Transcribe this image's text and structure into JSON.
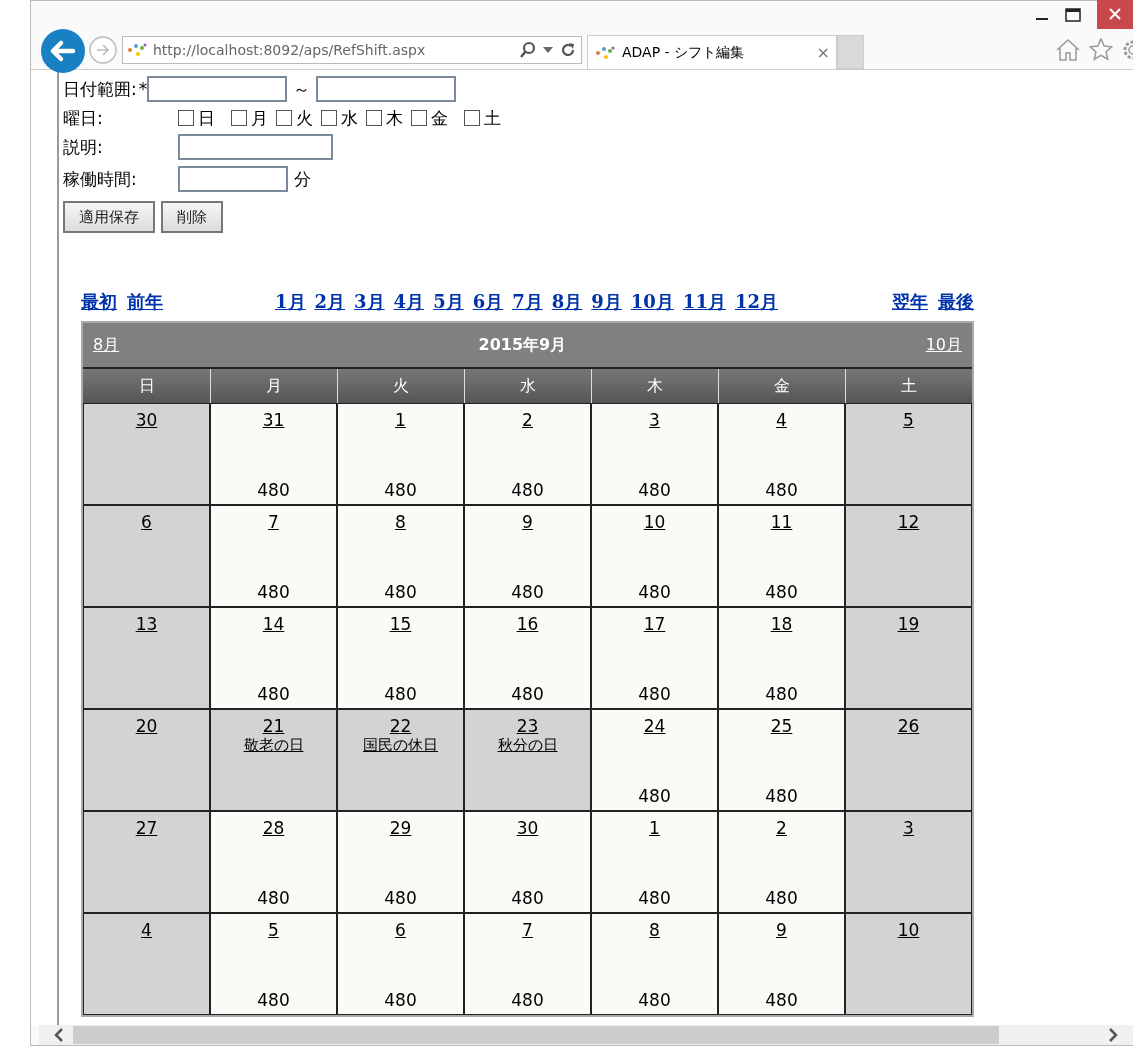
{
  "browser": {
    "url": "http://localhost:8092/aps/RefShift.aspx",
    "tab_title": "ADAP - シフト編集",
    "tab_close": "×"
  },
  "form": {
    "date_range_label": "日付範囲:",
    "required_mark": "*",
    "range_separator": "～",
    "weekday_label": "曜日:",
    "weekdays": [
      {
        "label": "日",
        "checked": false
      },
      {
        "label": "月",
        "checked": false
      },
      {
        "label": "火",
        "checked": false
      },
      {
        "label": "水",
        "checked": false
      },
      {
        "label": "木",
        "checked": false
      },
      {
        "label": "金",
        "checked": false
      },
      {
        "label": "土",
        "checked": false
      }
    ],
    "description_label": "説明:",
    "hours_label": "稼働時間:",
    "hours_unit": "分",
    "buttons": [
      "適用保存",
      "削除"
    ]
  },
  "nav": {
    "left": [
      "最初",
      "前年"
    ],
    "months": [
      "1月",
      "2月",
      "3月",
      "4月",
      "5月",
      "6月",
      "7月",
      "8月",
      "9月",
      "10月",
      "11月",
      "12月"
    ],
    "right": [
      "翌年",
      "最後"
    ]
  },
  "calendar": {
    "prev": "8月",
    "title": "2015年9月",
    "next": "10月",
    "day_headers": [
      "日",
      "月",
      "火",
      "水",
      "木",
      "金",
      "土"
    ],
    "weeks": [
      [
        {
          "day": "30",
          "off": true
        },
        {
          "day": "31",
          "off": false,
          "minutes": "480"
        },
        {
          "day": "1",
          "off": false,
          "minutes": "480"
        },
        {
          "day": "2",
          "off": false,
          "minutes": "480"
        },
        {
          "day": "3",
          "off": false,
          "minutes": "480"
        },
        {
          "day": "4",
          "off": false,
          "minutes": "480"
        },
        {
          "day": "5",
          "off": true
        }
      ],
      [
        {
          "day": "6",
          "off": true
        },
        {
          "day": "7",
          "off": false,
          "minutes": "480"
        },
        {
          "day": "8",
          "off": false,
          "minutes": "480"
        },
        {
          "day": "9",
          "off": false,
          "minutes": "480"
        },
        {
          "day": "10",
          "off": false,
          "minutes": "480"
        },
        {
          "day": "11",
          "off": false,
          "minutes": "480"
        },
        {
          "day": "12",
          "off": true
        }
      ],
      [
        {
          "day": "13",
          "off": true
        },
        {
          "day": "14",
          "off": false,
          "minutes": "480"
        },
        {
          "day": "15",
          "off": false,
          "minutes": "480"
        },
        {
          "day": "16",
          "off": false,
          "minutes": "480"
        },
        {
          "day": "17",
          "off": false,
          "minutes": "480"
        },
        {
          "day": "18",
          "off": false,
          "minutes": "480"
        },
        {
          "day": "19",
          "off": true
        }
      ],
      [
        {
          "day": "20",
          "off": true
        },
        {
          "day": "21",
          "off": true,
          "holiday": "敬老の日"
        },
        {
          "day": "22",
          "off": true,
          "holiday": "国民の休日"
        },
        {
          "day": "23",
          "off": true,
          "holiday": "秋分の日"
        },
        {
          "day": "24",
          "off": false,
          "minutes": "480"
        },
        {
          "day": "25",
          "off": false,
          "minutes": "480"
        },
        {
          "day": "26",
          "off": true
        }
      ],
      [
        {
          "day": "27",
          "off": true
        },
        {
          "day": "28",
          "off": false,
          "minutes": "480"
        },
        {
          "day": "29",
          "off": false,
          "minutes": "480"
        },
        {
          "day": "30",
          "off": false,
          "minutes": "480"
        },
        {
          "day": "1",
          "off": false,
          "minutes": "480"
        },
        {
          "day": "2",
          "off": false,
          "minutes": "480"
        },
        {
          "day": "3",
          "off": true
        }
      ],
      [
        {
          "day": "4",
          "off": true
        },
        {
          "day": "5",
          "off": false,
          "minutes": "480"
        },
        {
          "day": "6",
          "off": false,
          "minutes": "480"
        },
        {
          "day": "7",
          "off": false,
          "minutes": "480"
        },
        {
          "day": "8",
          "off": false,
          "minutes": "480"
        },
        {
          "day": "9",
          "off": false,
          "minutes": "480"
        },
        {
          "day": "10",
          "off": true
        }
      ]
    ]
  }
}
